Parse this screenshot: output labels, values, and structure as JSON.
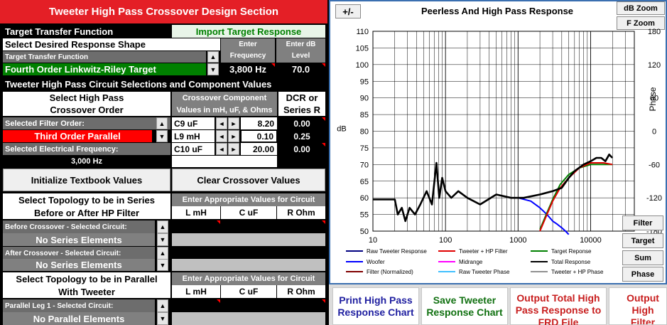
{
  "left": {
    "title": "Tweeter High Pass Crossover Design Section",
    "target_transfer_function_label": "Target Transfer Function",
    "import_target_button": "Import Target Response",
    "select_response_shape": "Select Desired Response Shape",
    "enter_frequency_header": "Enter\nFrequency",
    "enter_db_header": "Enter dB\nLevel",
    "target_transfer_function_small": "Target Transfer Function",
    "target_value": "Fourth Order Linkwitz-Riley Target",
    "frequency_value": "3,800 Hz",
    "db_level_value": "70.0",
    "circuit_selections_header": "Tweeter High Pass Circuit Selections and Component Values",
    "select_hp_order_line1": "Select High Pass",
    "select_hp_order_line2": "Crossover Order",
    "component_header_line1": "Crossover Component",
    "component_header_line2": "Values in mH, uF, & Ohms",
    "dcr_header_line1": "DCR or",
    "dcr_header_line2": "Series R",
    "selected_filter_order_label": "Selected Filter Order:",
    "filter_order_value": "Third Order Parallel",
    "selected_freq_label": "Selected Electrical Frequency:",
    "selected_freq_value": "3,000 Hz",
    "components": [
      {
        "name": "C9  uF",
        "value": "8.20",
        "dcr": "0.00"
      },
      {
        "name": "L9 mH",
        "value": "0.10",
        "dcr": "0.25"
      },
      {
        "name": "C10  uF",
        "value": "20.00",
        "dcr": "0.00"
      }
    ],
    "init_button": "Initialize Textbook Values",
    "clear_button": "Clear Crossover Values",
    "series_topology_line1": "Select Topology to be in Series",
    "series_topology_line2": "Before or After HP Filter",
    "enter_values_header": "Enter Appropriate Values for Circuit",
    "col_l": "L mH",
    "col_c": "C uF",
    "col_r": "R Ohm",
    "before_crossover_label": "Before Crossover - Selected Circuit:",
    "before_crossover_value": "No Series Elements",
    "after_crossover_label": "After Crossover - Selected Circuit:",
    "after_crossover_value": "No Series Elements",
    "parallel_topology_line1": "Select Topology to be in Parallel",
    "parallel_topology_line2": "With Tweeter",
    "enter_values_header2": "Enter Appropriate Values for Circuit",
    "parallel_leg_label": "Parallel Leg 1 - Selected Circuit:",
    "parallel_leg_value": "No Parallel Elements"
  },
  "chart_panel": {
    "plusminus_button": "+/-",
    "db_zoom_button": "dB Zoom",
    "f_zoom_button": "F Zoom",
    "filter_button": "Filter",
    "target_button": "Target",
    "sum_button": "Sum",
    "phase_button": "Phase"
  },
  "chart_data": {
    "type": "line",
    "title": "Peerless  And High Pass Response",
    "xlabel": "",
    "ylabel": "dB",
    "y2label": "Phase",
    "x_scale": "log",
    "xlim": [
      10,
      40000
    ],
    "ylim": [
      50,
      110
    ],
    "y2lim": [
      -180,
      180
    ],
    "x_ticks": [
      "10",
      "100",
      "1000",
      "10000"
    ],
    "y_ticks": [
      "50",
      "55",
      "60",
      "65",
      "70",
      "75",
      "80",
      "85",
      "90",
      "95",
      "100",
      "105",
      "110"
    ],
    "y2_ticks": [
      "-180",
      "-120",
      "-60",
      "0",
      "60",
      "120",
      "180"
    ],
    "grid": true,
    "legend": [
      "Raw Tweeter Response",
      "Tweeter + HP Filter",
      "Target Reponse",
      "Woofer",
      "Midrange",
      "Total Response",
      "Filter (Normalized)",
      "Raw Tweeter Phase",
      "Tweeter + HP Phase"
    ],
    "legend_colors": [
      "#000080",
      "#e00000",
      "#008000",
      "#0000ff",
      "#ff00ff",
      "#000000",
      "#800000",
      "#40c0ff",
      "#909090"
    ],
    "series": [
      {
        "name": "Total Response",
        "color": "#000000",
        "x": [
          10,
          20,
          22,
          25,
          28,
          32,
          38,
          45,
          55,
          65,
          75,
          82,
          90,
          100,
          120,
          150,
          200,
          300,
          500,
          800,
          1200,
          2000,
          3000,
          4000,
          5000,
          6000,
          8000,
          10000,
          12000,
          14000,
          16000,
          18000,
          20000
        ],
        "y": [
          59.5,
          59.5,
          55,
          57,
          53,
          57,
          55,
          58,
          62,
          58,
          70.5,
          60,
          66,
          62,
          60,
          62,
          60,
          58,
          61,
          60,
          60,
          61,
          62,
          63,
          66,
          68,
          70,
          71,
          72,
          72,
          71,
          73,
          72
        ]
      },
      {
        "name": "Tweeter + HP Filter",
        "color": "#e00000",
        "x": [
          2000,
          2500,
          3000,
          3800,
          5000,
          7000,
          10000,
          15000,
          20000
        ],
        "y": [
          50,
          55,
          59,
          63,
          66,
          69,
          70.5,
          70.5,
          70
        ]
      },
      {
        "name": "Target Reponse",
        "color": "#008000",
        "x": [
          2000,
          2500,
          3000,
          3800,
          5000,
          7000,
          10000,
          15000,
          20000
        ],
        "y": [
          50.5,
          55.5,
          59.5,
          64,
          67,
          69,
          70,
          70,
          70
        ]
      },
      {
        "name": "Woofer",
        "color": "#0000ff",
        "x": [
          1000,
          1500,
          2000,
          2500,
          3000,
          3500,
          4000,
          4500,
          5000
        ],
        "y": [
          60,
          59,
          57,
          55,
          53,
          52,
          51,
          50,
          49
        ]
      }
    ]
  },
  "bottom_buttons": {
    "print_button": "Print High Pass\nResponse Chart",
    "save_button": "Save Tweeter\nResponse Chart",
    "output_total_button": "Output Total High\nPass Response to\nFRD File",
    "output_filter_button": "Output High\nFilter Resp\nFRD F"
  }
}
